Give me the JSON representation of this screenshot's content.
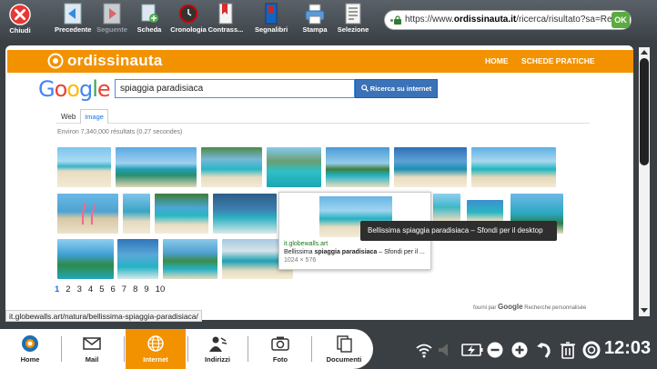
{
  "toolbar": {
    "close_label": "Chiudi",
    "buttons": [
      {
        "label": "Precedente",
        "icon": "back-arrow-icon"
      },
      {
        "label": "Seguente",
        "icon": "forward-arrow-icon"
      },
      {
        "label": "Scheda",
        "icon": "new-tab-icon"
      },
      {
        "label": "Cronologia",
        "icon": "history-icon"
      },
      {
        "label": "Contrass...",
        "icon": "bookmark-icon"
      },
      {
        "label": "Segnalibri",
        "icon": "bookmarks-icon"
      },
      {
        "label": "Stampa",
        "icon": "printer-icon"
      },
      {
        "label": "Selezione",
        "icon": "selection-icon"
      }
    ],
    "url_prefix": "https://www.",
    "url_domain": "ordissinauta.it",
    "url_rest": "/ricerca/risultato?sa=Recherche",
    "ok_label": "OK"
  },
  "site": {
    "logo": "ordissinauta",
    "nav": {
      "home": "HOME",
      "schede": "SCHEDE PRATICHE"
    }
  },
  "google": {
    "logo": "Google",
    "search_value": "spiaggia paradisiaca",
    "search_button": "Ricerca su internet",
    "tab_web": "Web",
    "tab_image": "Image",
    "results_text": "Environ 7,340,000 résultats (0.27 secondes)",
    "pages": [
      "1",
      "2",
      "3",
      "4",
      "5",
      "6",
      "7",
      "8",
      "9",
      "10"
    ],
    "footer_prefix": "fourni par",
    "footer_brand": "Google",
    "footer_suffix": "Recherche personnalisée"
  },
  "popup": {
    "url": "it.globewalls.art",
    "title_pre": "Bellissima ",
    "title_bold": "spiaggia paradisiaca",
    "title_post": " – Sfondi per il ...",
    "size": "1024 × 576",
    "tooltip": "Bellissima spiaggia paradisiaca – Sfondi per il desktop"
  },
  "status_url": "it.globewalls.art/natura/bellissima-spiaggia-paradisiaca/",
  "taskbar": {
    "items": [
      {
        "label": "Home",
        "icon": "home-icon"
      },
      {
        "label": "Mail",
        "icon": "mail-icon"
      },
      {
        "label": "Internet",
        "icon": "globe-icon",
        "active": true
      },
      {
        "label": "Indirizzi",
        "icon": "contacts-icon"
      },
      {
        "label": "Foto",
        "icon": "camera-icon"
      },
      {
        "label": "Documenti",
        "icon": "documents-icon"
      }
    ],
    "clock": "12:03"
  },
  "colors": {
    "accent": "#f39200",
    "ok_green": "#5cab42",
    "search_blue": "#3b72b8"
  }
}
